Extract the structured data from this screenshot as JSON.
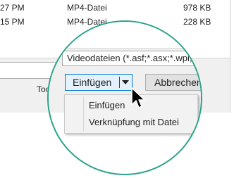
{
  "file_rows": [
    {
      "time": "27 PM",
      "type": "MP4-Datei",
      "size": "978 KB"
    },
    {
      "time": "15 PM",
      "type": "MP4-Datei",
      "size": "228 KB"
    }
  ],
  "tools_label": "Tool",
  "file_type_filter": "Videodateien (*.asf;*.asx;*.wpl;",
  "insert_button_label": "Einfügen",
  "cancel_button_label": "Abbrechen",
  "insert_menu": {
    "items": [
      {
        "label": "Einfügen"
      },
      {
        "label": "Verknüpfung mit Datei"
      }
    ]
  },
  "colors": {
    "lens_ring": "#2aa38a",
    "focused_button_border": "#0078d7",
    "focused_button_fill": "#e5f1fb"
  }
}
